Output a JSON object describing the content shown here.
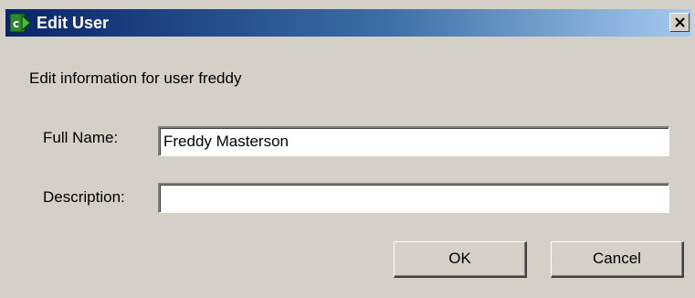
{
  "window": {
    "title": "Edit User",
    "app_icon": "app-arrow-icon",
    "close_glyph": "×"
  },
  "form": {
    "heading": "Edit information for user freddy",
    "full_name_label": "Full Name:",
    "full_name_value": "Freddy Masterson",
    "description_label": "Description:",
    "description_value": ""
  },
  "buttons": {
    "ok_label": "OK",
    "cancel_label": "Cancel"
  },
  "colors": {
    "title_gradient_start": "#0a246a",
    "title_gradient_end": "#a6caf0",
    "face": "#d4d0c8"
  }
}
